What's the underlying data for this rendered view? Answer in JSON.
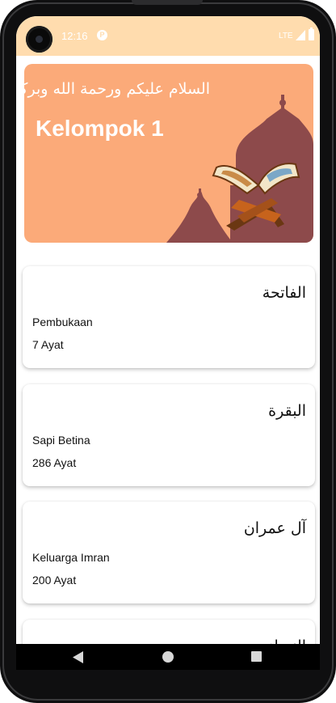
{
  "status_bar": {
    "time": "12:16",
    "notification_icon": "app-notification-icon",
    "network": "LTE",
    "icons": [
      "signal-icon",
      "battery-icon"
    ]
  },
  "banner": {
    "greeting": "السلام عليكم ورحمة الله وبركاته",
    "title": "Kelompok 1",
    "illustration": "mosque-quran-illustration",
    "colors": {
      "background": "#fbaa79",
      "mosque": "#8d4a4b"
    }
  },
  "surahs": [
    {
      "arabic": "الفاتحة",
      "meaning": "Pembukaan",
      "ayat": "7 Ayat"
    },
    {
      "arabic": "البقرة",
      "meaning": "Sapi Betina",
      "ayat": "286 Ayat"
    },
    {
      "arabic": "آل عمران",
      "meaning": "Keluarga Imran",
      "ayat": "200 Ayat"
    },
    {
      "arabic": "النساء"
    }
  ],
  "nav_bar": {
    "buttons": [
      "back-icon",
      "home-icon",
      "recent-apps-icon"
    ]
  },
  "colors": {
    "status_bar": "#ffdcae",
    "accent": "#fbaa79"
  }
}
